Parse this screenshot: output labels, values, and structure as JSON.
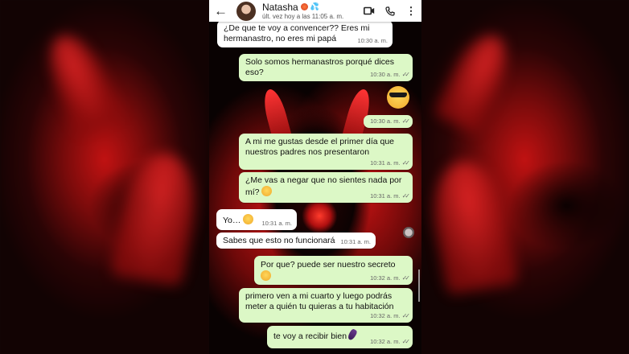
{
  "header": {
    "contact_name": "Natasha",
    "last_seen": "últ. vez hoy a las 11:05 a. m."
  },
  "messages": [
    {
      "dir": "in",
      "text": "¿De que te voy a convencer?? Eres mi hermanastro, no eres mi papá",
      "time": "10:30 a. m."
    },
    {
      "dir": "out",
      "text": "Solo somos hermanastros porqué dices eso?",
      "time": "10:30 a. m."
    },
    {
      "dir": "out",
      "text": "",
      "emoji": "sunglasses-emoji",
      "time": "10:30 a. m."
    },
    {
      "dir": "out",
      "text": "A mi me gustas desde el primer día que nuestros padres nos presentaron",
      "time": "10:31 a. m."
    },
    {
      "dir": "out",
      "text": "¿Me vas a negar que no sientes nada por mí?",
      "emoji": "smirk-emoji",
      "time": "10:31 a. m."
    },
    {
      "dir": "in",
      "text": "Yo…",
      "emoji": "worried-emoji",
      "time": "10:31 a. m."
    },
    {
      "dir": "in",
      "text": "Sabes que esto no funcionará",
      "time": "10:31 a. m."
    },
    {
      "dir": "out",
      "text": "Por que? puede ser nuestro secreto",
      "emoji": "kiss-emoji",
      "time": "10:32 a. m."
    },
    {
      "dir": "out",
      "text": "primero ven a mi cuarto y luego podrás meter a quién tu quieras a tu habitación",
      "time": "10:32 a. m."
    },
    {
      "dir": "out",
      "text": "te voy a recibir bien",
      "emoji": "eggplant-emoji",
      "time": "10:32 a. m."
    }
  ],
  "colors": {
    "incoming": "#ffffff",
    "outgoing": "#dcf8c6",
    "header": "#ffffff",
    "background_red": "#c31313"
  },
  "icons": [
    "back-arrow-icon",
    "video-call-icon",
    "phone-icon",
    "more-options-icon",
    "double-check-icon"
  ]
}
